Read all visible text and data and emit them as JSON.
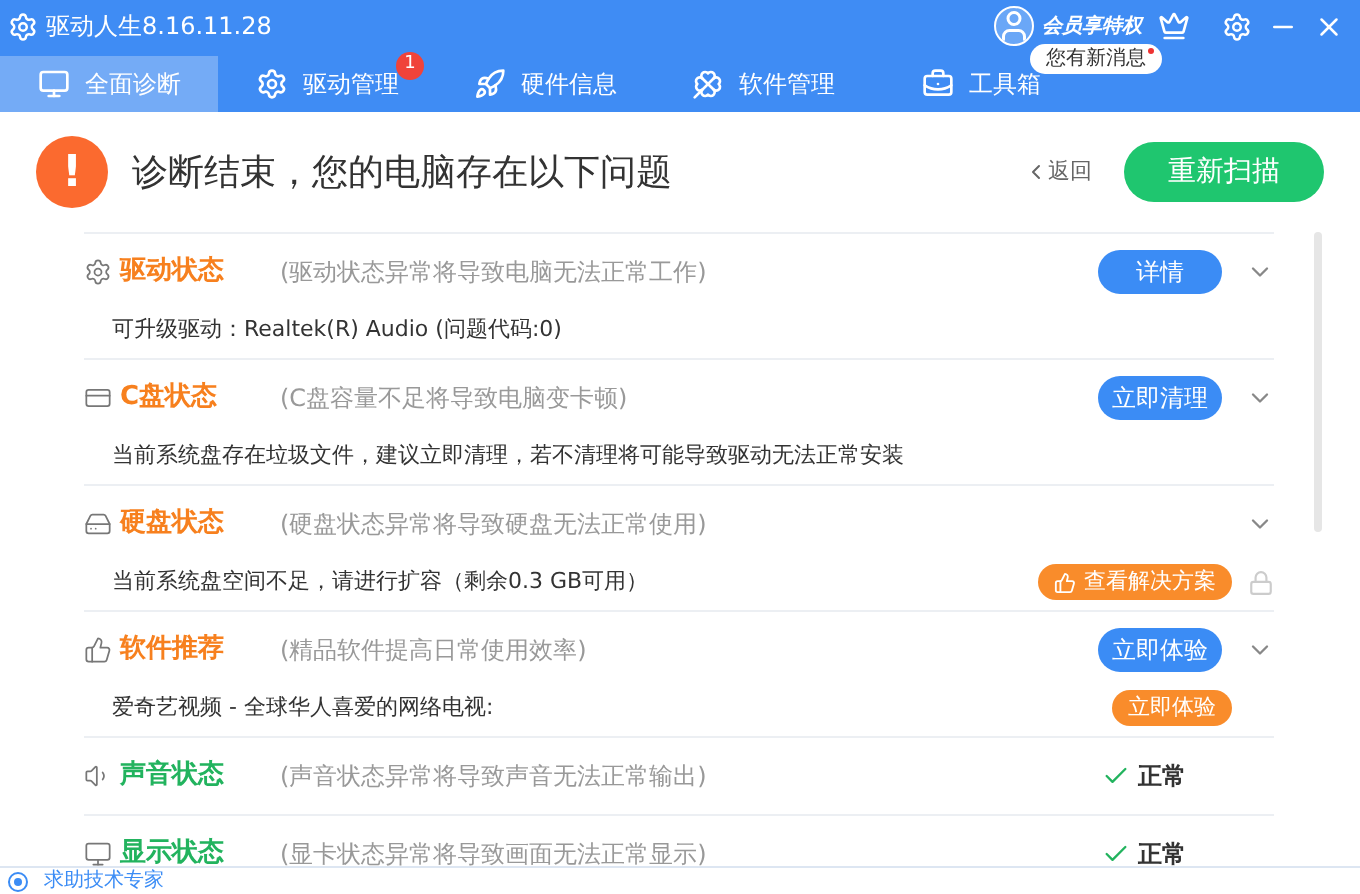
{
  "window": {
    "title": "驱动人生8.16.11.28",
    "member_label": "会员享特权",
    "message_tip": "您有新消息",
    "message_unread": true
  },
  "tabs": [
    {
      "label": "全面诊断",
      "selected": true
    },
    {
      "label": "驱动管理",
      "selected": false,
      "badge": "1"
    },
    {
      "label": "硬件信息",
      "selected": false
    },
    {
      "label": "软件管理",
      "selected": false
    },
    {
      "label": "工具箱",
      "selected": false
    }
  ],
  "header": {
    "alert_mark": "!",
    "title": "诊断结束，您的电脑存在以下问题",
    "back": "返回",
    "rescan": "重新扫描"
  },
  "sections": [
    {
      "kind": "problem",
      "title": "驱动状态",
      "desc": "(驱动状态异常将导致电脑无法正常工作)",
      "action": "详情",
      "detail": {
        "text": "可升级驱动：Realtek(R) Audio (问题代码:0)"
      }
    },
    {
      "kind": "problem",
      "title": "C盘状态",
      "desc": "(C盘容量不足将导致电脑变卡顿)",
      "action": "立即清理",
      "detail": {
        "text": "当前系统盘存在垃圾文件，建议立即清理，若不清理将可能导致驱动无法正常安装"
      }
    },
    {
      "kind": "problem",
      "title": "硬盘状态",
      "desc": "(硬盘状态异常将导致硬盘无法正常使用)",
      "detail": {
        "text": "当前系统盘空间不足，请进行扩容（剩余0.3 GB可用）",
        "button": "查看解决方案",
        "locked": true
      }
    },
    {
      "kind": "problem",
      "title": "软件推荐",
      "desc": "(精品软件提高日常使用效率)",
      "action": "立即体验",
      "detail": {
        "text": "爱奇艺视频 - 全球华人喜爱的网络电视:",
        "button": "立即体验",
        "locked": false
      }
    },
    {
      "kind": "normal",
      "title": "声音状态",
      "desc": "(声音状态异常将导致声音无法正常输出)",
      "result": "正常"
    },
    {
      "kind": "normal",
      "title": "显示状态",
      "desc": "(显卡状态异常将导致画面无法正常显示)",
      "result": "正常"
    }
  ],
  "footer": {
    "help": "求助技术专家"
  }
}
